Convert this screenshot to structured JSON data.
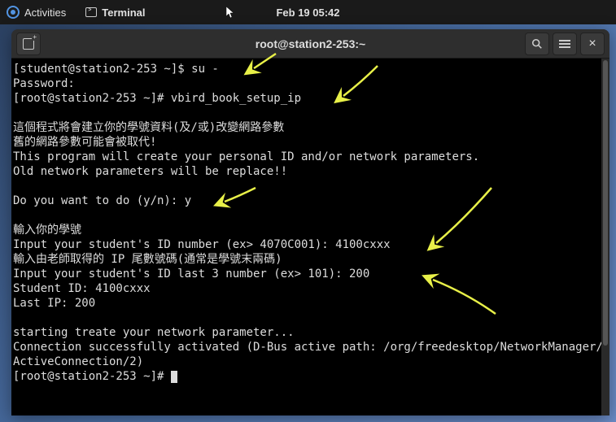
{
  "topbar": {
    "activities_label": "Activities",
    "app_label": "Terminal",
    "clock": "Feb 19  05:42"
  },
  "window": {
    "title": "root@station2-253:~"
  },
  "terminal": {
    "lines": [
      "[student@station2-253 ~]$ su -",
      "Password: ",
      "[root@station2-253 ~]# vbird_book_setup_ip",
      "",
      "這個程式將會建立你的學號資料(及/或)改變網路參數",
      "舊的網路參數可能會被取代!",
      "This program will create your personal ID and/or network parameters.",
      "Old network parameters will be replace!!",
      "",
      "Do you want to do (y/n): y",
      "",
      "輸入你的學號",
      "Input your student's ID number (ex> 4070C001): 4100cxxx",
      "輸入由老師取得的 IP 尾數號碼(通常是學號末兩碼)",
      "Input your student's ID last 3 number (ex> 101): 200",
      "Student ID: 4100cxxx",
      "Last IP: 200",
      "",
      "starting treate your network parameter...",
      "Connection successfully activated (D-Bus active path: /org/freedesktop/NetworkManager/ActiveConnection/2)"
    ],
    "prompt_final": "[root@station2-253 ~]# "
  },
  "annotations": {
    "arrow_color": "#e8f048"
  }
}
